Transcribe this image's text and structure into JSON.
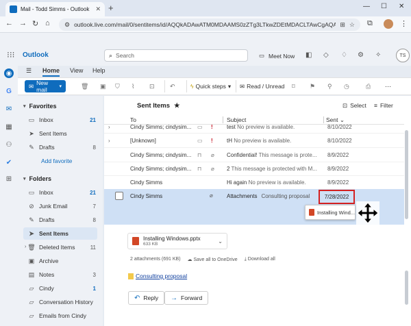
{
  "browser": {
    "tab_title": "Mail - Todd Simms - Outlook",
    "url": "outlook.live.com/mail/0/sentitems/id/AQQkADAwATM0MDAAMS0zZTg3LTkwZDEtMDACLTAwCgAQAH..."
  },
  "header": {
    "brand": "Outlook",
    "search_placeholder": "Search",
    "meet_now": "Meet Now",
    "avatar_initials": "TS"
  },
  "ribbon": {
    "tabs": [
      "Home",
      "View",
      "Help"
    ],
    "new_mail": "New mail",
    "quick_steps": "Quick steps",
    "read_unread": "Read / Unread"
  },
  "folders": {
    "favorites_label": "Favorites",
    "favorites": [
      {
        "icon": "inbox-icon",
        "label": "Inbox",
        "count": "21"
      },
      {
        "icon": "sent-icon",
        "label": "Sent Items",
        "count": ""
      },
      {
        "icon": "drafts-icon",
        "label": "Drafts",
        "count": "8"
      }
    ],
    "add_favorite": "Add favorite",
    "folders_label": "Folders",
    "items": [
      {
        "icon": "inbox-icon",
        "label": "Inbox",
        "count": "21"
      },
      {
        "icon": "junk-icon",
        "label": "Junk Email",
        "count": "7"
      },
      {
        "icon": "drafts-icon",
        "label": "Drafts",
        "count": "8"
      },
      {
        "icon": "sent-icon",
        "label": "Sent Items",
        "count": ""
      },
      {
        "icon": "trash-icon",
        "label": "Deleted Items",
        "count": "11"
      },
      {
        "icon": "archive-icon",
        "label": "Archive",
        "count": ""
      },
      {
        "icon": "notes-icon",
        "label": "Notes",
        "count": "3"
      },
      {
        "icon": "folder-icon",
        "label": "Cindy",
        "count": "1"
      },
      {
        "icon": "folder-icon",
        "label": "Conversation History",
        "count": ""
      },
      {
        "icon": "folder-icon",
        "label": "Emails from Cindy",
        "count": ""
      }
    ]
  },
  "list": {
    "title": "Sent Items",
    "select": "Select",
    "filter": "Filter",
    "columns": {
      "to": "To",
      "subject": "Subject",
      "sent": "Sent"
    },
    "rows": [
      {
        "expand": "›",
        "to": "Cindy Simms; cindysim...",
        "subject": "test",
        "preview": "No preview is available.",
        "date": "8/10/2022"
      },
      {
        "expand": "›",
        "to": "[Unknown]",
        "subject": "tH",
        "preview": "No preview is available.",
        "date": "8/10/2022"
      },
      {
        "expand": "",
        "to": "Cindy Simms; cindysim...",
        "subject": "Confidential!",
        "preview": "This message is prote...",
        "date": "8/9/2022"
      },
      {
        "expand": "",
        "to": "Cindy Simms; cindysim...",
        "subject": "2",
        "preview": "This message is protected with M...",
        "date": "8/9/2022"
      },
      {
        "expand": "",
        "to": "Cindy Simms",
        "subject": "Hi again",
        "preview": "No preview is available.",
        "date": "8/9/2022"
      }
    ],
    "selected": {
      "to": "Cindy Simms",
      "subject": "Attachments",
      "preview": "Consulting proposal",
      "date": "7/28/2022",
      "drag_chip": "Installing Wind..."
    }
  },
  "preview": {
    "attachment_name": "Installing Windows.pptx",
    "attachment_size": "633 KB",
    "attachments_summary": "2 attachments (691 KB)",
    "save_onedrive": "Save all to OneDrive",
    "download_all": "Download all",
    "doc_link": "Consulting proposal",
    "reply": "Reply",
    "forward": "Forward"
  }
}
